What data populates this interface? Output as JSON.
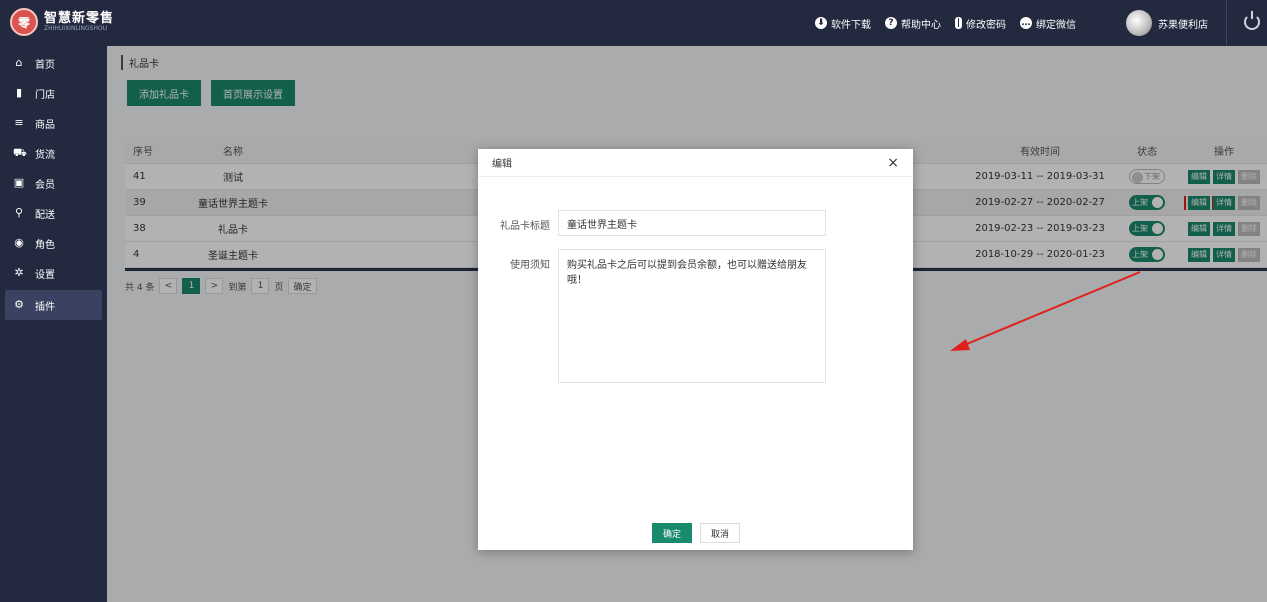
{
  "app": {
    "logo_mark": "零",
    "name": "智慧新零售",
    "name_sub": "ZHIHUIXINLINGSHOU"
  },
  "header": {
    "links": [
      {
        "icon": "download-icon",
        "label": "软件下载"
      },
      {
        "icon": "help-icon",
        "label": "帮助中心"
      },
      {
        "icon": "thermometer-icon",
        "label": "修改密码"
      },
      {
        "icon": "chat-icon",
        "label": "绑定微信"
      }
    ],
    "user_name": "苏果便利店"
  },
  "sidebar": {
    "items": [
      {
        "icon": "home-icon",
        "glyph": "⌂",
        "label": "首页"
      },
      {
        "icon": "store-icon",
        "glyph": "▮",
        "label": "门店"
      },
      {
        "icon": "list-icon",
        "glyph": "≡",
        "label": "商品"
      },
      {
        "icon": "truck-icon",
        "glyph": "⛟",
        "label": "货流"
      },
      {
        "icon": "member-card-icon",
        "glyph": "▣",
        "label": "会员"
      },
      {
        "icon": "delivery-icon",
        "glyph": "⚲",
        "label": "配送"
      },
      {
        "icon": "role-icon",
        "glyph": "◉",
        "label": "角色"
      },
      {
        "icon": "settings-icon",
        "glyph": "✲",
        "label": "设置"
      },
      {
        "icon": "plugin-icon",
        "glyph": "⚙",
        "label": "插件"
      }
    ],
    "active_index": 8
  },
  "page": {
    "breadcrumb": "礼品卡",
    "add_button": "添加礼品卡",
    "home_display_button": "首页展示设置"
  },
  "table": {
    "headers": {
      "no": "序号",
      "name": "名称",
      "desc": "",
      "time": "有效时间",
      "status": "状态",
      "ops": "操作"
    },
    "rows": [
      {
        "no": "41",
        "name": "测试",
        "time": "2019-03-11 -- 2019-03-31",
        "status": "下架",
        "status_on": false,
        "ops": {
          "edit": "编辑",
          "detail": "详情",
          "delete": "删除"
        }
      },
      {
        "no": "39",
        "name": "童话世界主题卡",
        "time": "2019-02-27 -- 2020-02-27",
        "status": "上架",
        "status_on": true,
        "ops": {
          "edit": "编辑",
          "detail": "详情",
          "delete": "删除"
        }
      },
      {
        "no": "38",
        "name": "礼品卡",
        "time": "2019-02-23 -- 2019-03-23",
        "status": "上架",
        "status_on": true,
        "ops": {
          "edit": "编辑",
          "detail": "详情",
          "delete": "删除"
        }
      },
      {
        "no": "4",
        "name": "圣诞主题卡",
        "time": "2018-10-29 -- 2020-01-23",
        "status": "上架",
        "status_on": true,
        "ops": {
          "edit": "编辑",
          "detail": "详情",
          "delete": "删除"
        }
      }
    ]
  },
  "pager": {
    "total": "共 4 条",
    "prev": "<",
    "current": "1",
    "next": ">",
    "goto_label": "到第",
    "goto_value": "1",
    "page_unit": "页",
    "confirm": "确定"
  },
  "modal": {
    "title": "编辑",
    "close": "×",
    "title_label": "礼品卡标题",
    "title_value": "童话世界主题卡",
    "notice_label": "使用须知",
    "notice_value": "购买礼品卡之后可以提到会员余额，也可以赠送给朋友哦！",
    "ok": "确定",
    "cancel": "取消"
  },
  "colors": {
    "sidebar": "#232a40",
    "accent": "#1a8a6e",
    "highlight": "#e0201b"
  }
}
